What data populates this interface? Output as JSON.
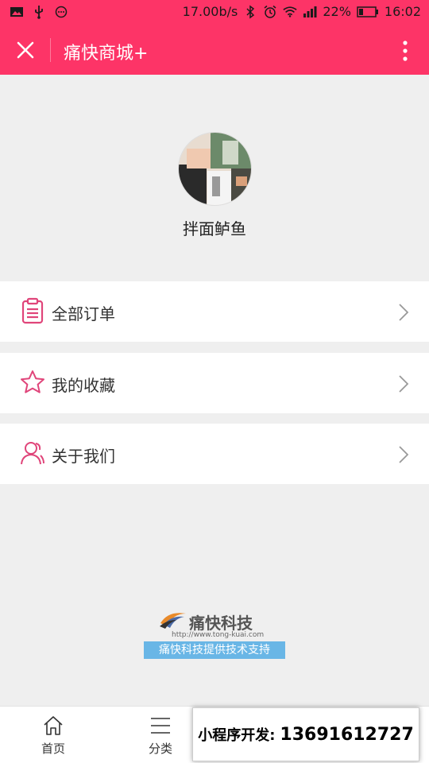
{
  "status_bar": {
    "speed": "17.00b/s",
    "battery": "22%",
    "time": "16:02",
    "icons": [
      "image-icon",
      "usb-icon",
      "more-icon",
      "bluetooth-icon",
      "alarm-icon",
      "wifi-icon",
      "signal-icon",
      "battery-icon"
    ]
  },
  "nav": {
    "title": "痛快商城+",
    "close_icon": "close-icon",
    "more_icon": "more-vertical-icon"
  },
  "profile": {
    "username": "拌面鲈鱼"
  },
  "menu": [
    {
      "label": "全部订单",
      "icon": "clipboard-icon"
    },
    {
      "label": "我的收藏",
      "icon": "star-icon"
    },
    {
      "label": "关于我们",
      "icon": "users-icon"
    }
  ],
  "brand": {
    "name": "痛快科技",
    "url": "http://www.tong-kuai.com",
    "tagline": "痛快科技提供技术支持"
  },
  "tabbar": [
    {
      "label": "首页",
      "icon": "home-icon"
    },
    {
      "label": "分类",
      "icon": "list-icon"
    }
  ],
  "promo": {
    "label": "小程序开发:",
    "phone": "13691612727"
  },
  "colors": {
    "accent": "#fd3467",
    "icon_pink": "#e0457a",
    "background": "#efefef",
    "tagline_bg": "#69b6e6"
  }
}
